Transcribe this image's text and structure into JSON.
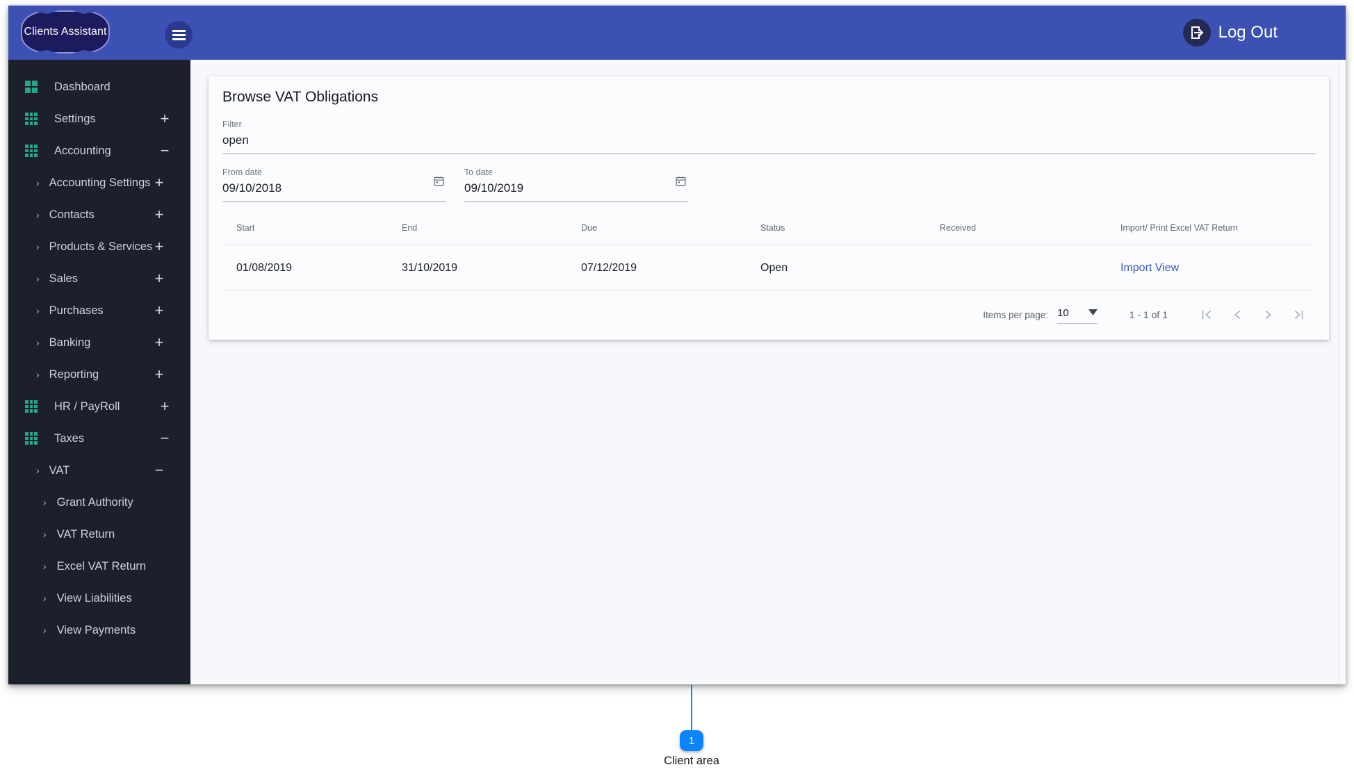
{
  "header": {
    "logo_text": "Clients Assistant",
    "menu_icon": "hamburger-menu-icon",
    "logout_label": "Log Out",
    "logout_icon": "logout-arrow-icon",
    "bar_color": "#3d51b5"
  },
  "sidebar": {
    "bg_color": "#1b202c",
    "icon_color": "#26a58f",
    "items": [
      {
        "label": "Dashboard",
        "level": 0,
        "icon": "grid-2x2-icon",
        "toggle": ""
      },
      {
        "label": "Settings",
        "level": 0,
        "icon": "grid-3x3-icon",
        "toggle": "+"
      },
      {
        "label": "Accounting",
        "level": 0,
        "icon": "grid-3x3-icon",
        "toggle": "−"
      },
      {
        "label": "Accounting Settings",
        "level": 1,
        "icon": "chevron-right-icon",
        "toggle": "+"
      },
      {
        "label": "Contacts",
        "level": 1,
        "icon": "chevron-right-icon",
        "toggle": "+"
      },
      {
        "label": "Products & Services",
        "level": 1,
        "icon": "chevron-right-icon",
        "toggle": "+"
      },
      {
        "label": "Sales",
        "level": 1,
        "icon": "chevron-right-icon",
        "toggle": "+"
      },
      {
        "label": "Purchases",
        "level": 1,
        "icon": "chevron-right-icon",
        "toggle": "+"
      },
      {
        "label": "Banking",
        "level": 1,
        "icon": "chevron-right-icon",
        "toggle": "+"
      },
      {
        "label": "Reporting",
        "level": 1,
        "icon": "chevron-right-icon",
        "toggle": "+"
      },
      {
        "label": "HR / PayRoll",
        "level": 0,
        "icon": "grid-3x3-icon",
        "toggle": "+"
      },
      {
        "label": "Taxes",
        "level": 0,
        "icon": "grid-3x3-icon",
        "toggle": "−"
      },
      {
        "label": "VAT",
        "level": 1,
        "icon": "chevron-right-icon",
        "toggle": "−"
      },
      {
        "label": "Grant Authority",
        "level": 2,
        "icon": "chevron-right-icon",
        "toggle": ""
      },
      {
        "label": "VAT Return",
        "level": 2,
        "icon": "chevron-right-icon",
        "toggle": ""
      },
      {
        "label": "Excel VAT Return",
        "level": 2,
        "icon": "chevron-right-icon",
        "toggle": ""
      },
      {
        "label": "View Liabilities",
        "level": 2,
        "icon": "chevron-right-icon",
        "toggle": ""
      },
      {
        "label": "View Payments",
        "level": 2,
        "icon": "chevron-right-icon",
        "toggle": ""
      }
    ]
  },
  "main": {
    "card_title": "Browse VAT Obligations",
    "filter": {
      "label": "Filter",
      "value": "open",
      "placeholder": "Filter"
    },
    "from_date": {
      "label": "From date",
      "value": "09/10/2018",
      "icon": "calendar-icon"
    },
    "to_date": {
      "label": "To date",
      "value": "09/10/2019",
      "icon": "calendar-icon"
    },
    "table": {
      "columns": [
        "Start",
        "End",
        "Due",
        "Status",
        "Received",
        "Import/ Print Excel VAT Return"
      ],
      "rows": [
        {
          "start": "01/08/2019",
          "end": "31/10/2019",
          "due": "07/12/2019",
          "status": "Open",
          "received": "",
          "action_import": "Import",
          "action_view": "View"
        }
      ],
      "link_color": "#3b59c6"
    },
    "paginator": {
      "items_per_page_label": "Items per page:",
      "items_per_page_value": "10",
      "range_label": "1 - 1 of 1",
      "first_icon": "first-page-icon",
      "prev_icon": "previous-page-icon",
      "next_icon": "next-page-icon",
      "last_icon": "last-page-icon"
    }
  },
  "annotation": {
    "badge_number": "1",
    "label": "Client area",
    "color": "#0a84ff"
  }
}
